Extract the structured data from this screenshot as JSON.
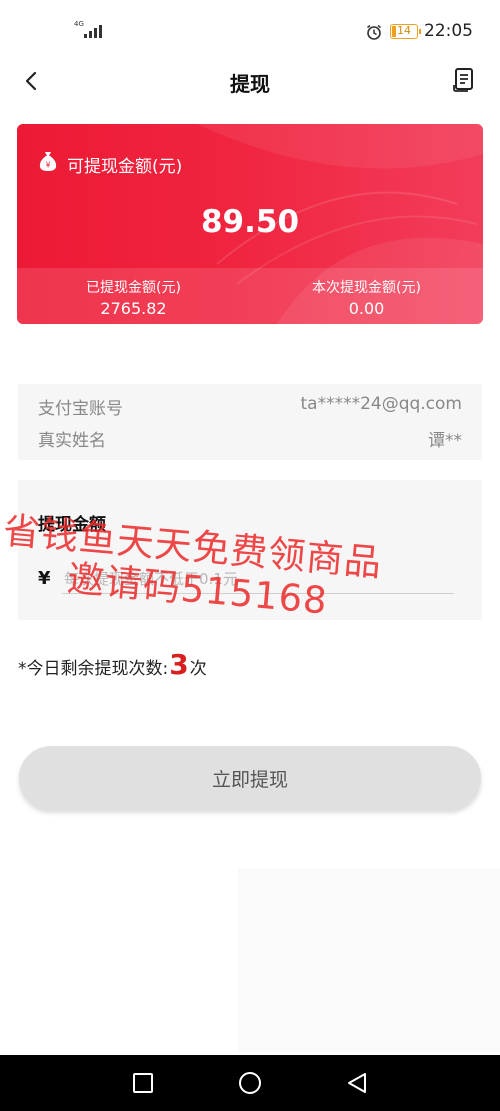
{
  "status_bar": {
    "network": "4G",
    "battery_level": "14",
    "time": "22:05",
    "icons": [
      "signal-icon",
      "alarm-icon",
      "battery-icon"
    ]
  },
  "nav": {
    "title": "提现",
    "back_icon": "chevron-left-icon",
    "record_icon": "document-icon"
  },
  "balance_card": {
    "available_label": "可提现金额(元)",
    "available_amount": "89.50",
    "withdrawn_label": "已提现金额(元)",
    "withdrawn_amount": "2765.82",
    "current_label": "本次提现金额(元)",
    "current_amount": "0.00",
    "icon": "money-bag-icon",
    "colors": {
      "primary": "#ec1a35",
      "secondary": "#f23d5a"
    }
  },
  "account": {
    "alipay_label": "支付宝账号",
    "alipay_value": "ta*****24@qq.com",
    "name_label": "真实姓名",
    "name_value": "谭**"
  },
  "amount_entry": {
    "title": "提现金额",
    "currency_symbol": "¥",
    "placeholder": "每次提现金额不低于0.1元",
    "value": ""
  },
  "remaining": {
    "prefix": "*今日剩余提现次数:",
    "count": "3",
    "suffix": "次",
    "count_color": "#d81e1e"
  },
  "withdraw_button": {
    "label": "立即提现"
  },
  "watermark": {
    "line1": "省钱鱼天天免费领商品",
    "line2": "邀请码515168"
  },
  "system_nav": {
    "icons": [
      "square-icon",
      "circle-icon",
      "triangle-back-icon"
    ]
  }
}
